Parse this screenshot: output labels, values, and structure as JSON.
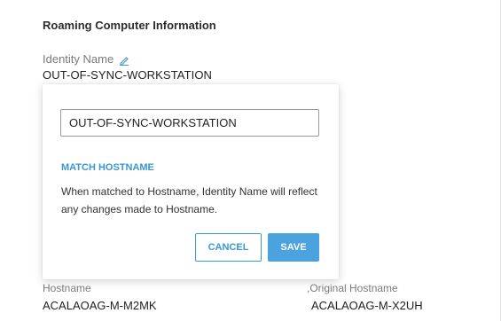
{
  "section": {
    "title": "Roaming Computer Information"
  },
  "identity": {
    "label": "Identity Name",
    "edit_icon": "pencil-icon",
    "value": "OUT-OF-SYNC-WORKSTATION"
  },
  "popover": {
    "input_value": "OUT-OF-SYNC-WORKSTATION",
    "match_link": "MATCH HOSTNAME",
    "help_text": "When matched to Hostname, Identity Name will reflect any changes made to Hostname.",
    "cancel_label": "CANCEL",
    "save_label": "SAVE"
  },
  "hostname": {
    "label": "Hostname",
    "value": "ACALAOAG-M-M2MK"
  },
  "original_hostname": {
    "label": ",Original Hostname",
    "value": "ACALAOAG-M-X2UH"
  },
  "colors": {
    "accent": "#3a97d4",
    "save_bg": "#4aa3df",
    "label": "#7a7a7a"
  }
}
